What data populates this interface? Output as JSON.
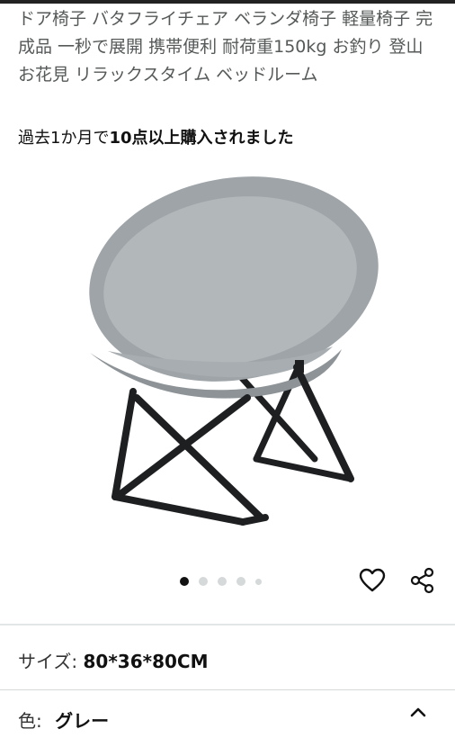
{
  "product": {
    "title": "ドア椅子 バタフライチェア ベランダ椅子 軽量椅子 完成品 一秒で展開 携帯便利 耐荷重150kg お釣り 登山 お花見 リラックスタイム ベッドルーム",
    "bought_prefix": "過去1か月で",
    "bought_bold": "10点以上購入されました",
    "image": {
      "alt": "gray round folding saucer chair"
    },
    "carousel": {
      "total": 5,
      "active_index": 0
    }
  },
  "actions": {
    "wishlist_icon": "heart-icon",
    "share_icon": "share-icon"
  },
  "variations": {
    "size_label": "サイズ:",
    "size_value": "80*36*80CM",
    "color_label": "色:",
    "color_value": "グレー",
    "color_toggle_icon": "chevron-up-icon"
  },
  "colors": {
    "text_primary": "#111111",
    "text_secondary": "#565959",
    "divider": "#d5d9d9",
    "chair_fabric": "#9ea4a8",
    "chair_frame": "#1d1f21"
  }
}
